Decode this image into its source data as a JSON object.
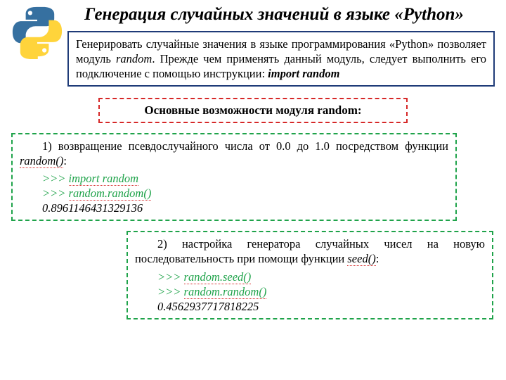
{
  "title": "Генерация случайных значений в языке «Python»",
  "intro": {
    "part1": "Генерировать случайные значения в языке программирования «Python» позволяет модуль ",
    "random_word": "random",
    "part2": ". Прежде чем применять данный модуль, следует выполнить его подключение с помощью инструкции: ",
    "import_stmt": "import random"
  },
  "section_label": "Основные возможности модуля random:",
  "ex1": {
    "lead_num": "1) ",
    "lead_text": "возвращение псевдослучайного числа от 0.0 до 1.0 посредством функции ",
    "func": "random()",
    "tail": ":",
    "code": {
      "line1a": ">>> ",
      "line1b": "import random",
      "line2a": ">>> ",
      "line2b": "random.random()",
      "line3": "0.8961146431329136"
    }
  },
  "ex2": {
    "lead_num": "2) ",
    "lead_text": "настройка генератора случайных чисел на новую последовательность при помощи функции ",
    "func": "seed()",
    "tail": ":",
    "code": {
      "line1a": ">>> ",
      "line1b": "random.seed()",
      "line2a": ">>> ",
      "line2b": "random.random()",
      "line3": "0.4562937717818225"
    }
  }
}
